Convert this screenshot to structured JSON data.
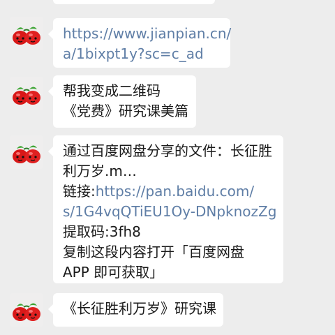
{
  "colors": {
    "background": "#ededed",
    "bubble": "#ffffff",
    "text": "#1a1a1a",
    "link": "#5f7ea6",
    "avatar_apple": "#e01e1e",
    "avatar_leaf": "#3fa535"
  },
  "avatar_icon": "red-apples-avatar-icon",
  "messages": [
    {
      "lines": [
        {
          "link": "https://www.jianpian.cn/"
        },
        {
          "link": "a/1bixpt1y?sc=c_ad"
        }
      ]
    },
    {
      "lines": [
        {
          "text": "帮我变成二维码"
        },
        {
          "text": "《党费》研究课美篇"
        }
      ]
    },
    {
      "lines": [
        {
          "text": "通过百度网盘分享的文件：长征胜"
        },
        {
          "text": "利万岁.m…"
        },
        {
          "text": "链接:",
          "link": "https://pan.baidu.com/"
        },
        {
          "link": "s/1G4vqQTiEU1Oy-DNpknozZg"
        },
        {
          "text": "提取码:3fh8"
        },
        {
          "text": "复制这段内容打开「百度网盘"
        },
        {
          "text": "APP 即可获取」"
        }
      ]
    },
    {
      "lines": [
        {
          "text": "《长征胜利万岁》研究课"
        }
      ]
    }
  ]
}
